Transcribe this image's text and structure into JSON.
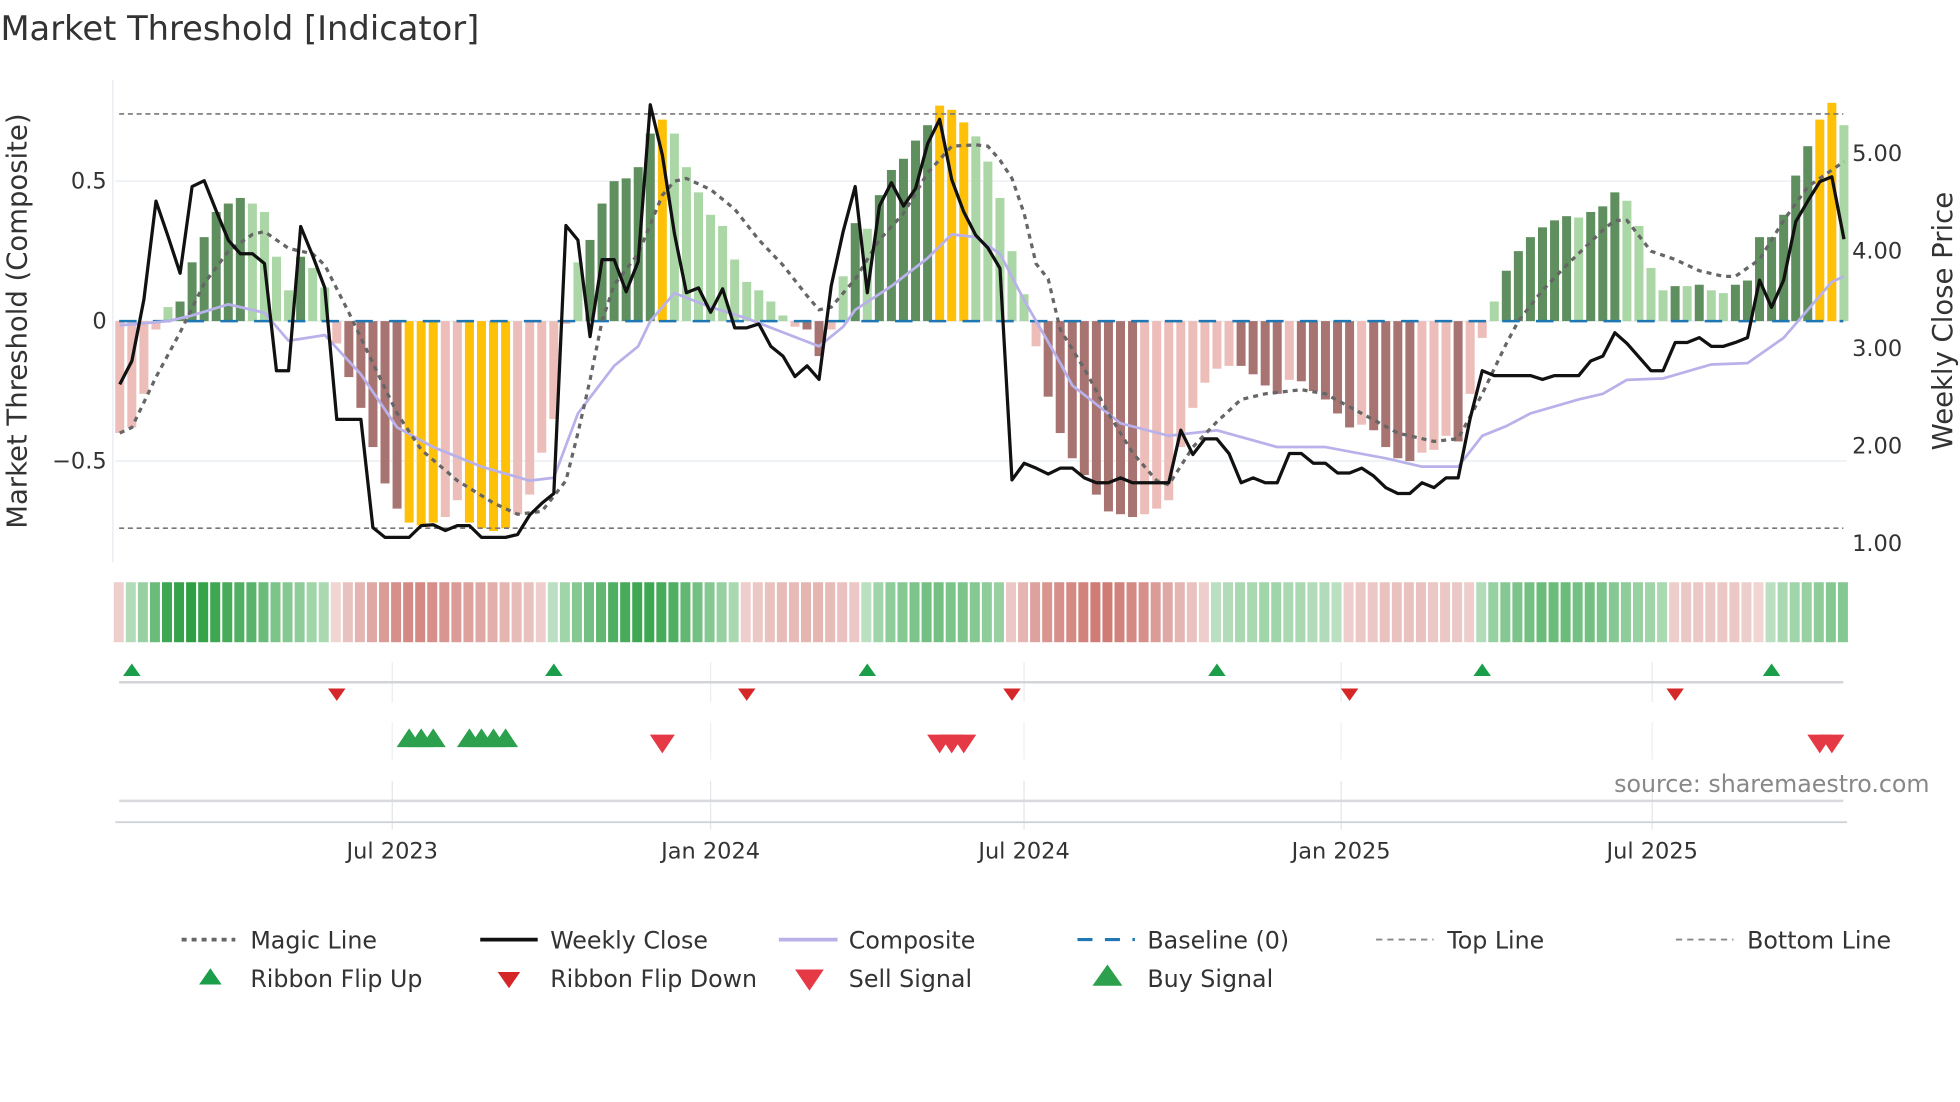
{
  "title": "Market Threshold [Indicator]",
  "source": "source: sharemaestro.com",
  "colors": {
    "dark_green": "#5f8f5f",
    "light_green": "#abd6a5",
    "dark_red": "#a87471",
    "light_red": "#ecbdb9",
    "yellow": "#ffc107",
    "magic": "#666666",
    "close": "#111111",
    "composite": "#b9b1ea",
    "baseline": "#1f77b4",
    "flip_up": "#1a9e4a",
    "flip_down": "#d62728",
    "sell": "#e63946",
    "buy": "#2ca04c",
    "ribbon_pos": "#2ea043",
    "ribbon_neg": "#c96a63"
  },
  "chart_data": {
    "type": "bar+line",
    "title": "Market Threshold [Indicator]",
    "ylabel_left": "Market Threshold (Composite)",
    "ylabel_right": "Weekly Close Price",
    "x_unit": "week index (weekly bars, ~Jan 2023 – Oct 2025)",
    "ylim_left": [
      -0.85,
      0.85
    ],
    "ylim_right": [
      0.8,
      5.7
    ],
    "left_ticks": [
      {
        "label": "0.5",
        "value": 0.5
      },
      {
        "label": "0",
        "value": 0
      },
      {
        "label": "−0.5",
        "value": -0.5
      }
    ],
    "right_ticks": [
      {
        "label": "5.00",
        "value": 5
      },
      {
        "label": "4.00",
        "value": 4
      },
      {
        "label": "3.00",
        "value": 3
      },
      {
        "label": "2.00",
        "value": 2
      },
      {
        "label": "1.00",
        "value": 1
      }
    ],
    "x_ticks": [
      {
        "label": "Jul 2023",
        "week": 22.6
      },
      {
        "label": "Jan 2024",
        "week": 49.0
      },
      {
        "label": "Jul 2024",
        "week": 75.0
      },
      {
        "label": "Jan 2025",
        "week": 101.3
      },
      {
        "label": "Jul 2025",
        "week": 127.1
      }
    ],
    "top_line": 0.74,
    "bottom_line": -0.74,
    "baseline": 0,
    "histogram": [
      -0.4,
      -0.38,
      -0.26,
      -0.03,
      0.05,
      0.07,
      0.21,
      0.3,
      0.39,
      0.42,
      0.44,
      0.42,
      0.39,
      0.23,
      0.11,
      0.23,
      0.19,
      0.12,
      -0.08,
      -0.2,
      -0.31,
      -0.45,
      -0.58,
      -0.67,
      -0.72,
      -0.73,
      -0.72,
      -0.7,
      -0.64,
      -0.72,
      -0.74,
      -0.75,
      -0.74,
      -0.69,
      -0.62,
      -0.47,
      -0.35,
      -0.01,
      0.21,
      0.29,
      0.42,
      0.5,
      0.51,
      0.55,
      0.67,
      0.72,
      0.67,
      0.55,
      0.46,
      0.38,
      0.34,
      0.22,
      0.14,
      0.11,
      0.07,
      0.02,
      -0.02,
      -0.03,
      -0.125,
      -0.03,
      0.16,
      0.35,
      0.33,
      0.45,
      0.54,
      0.58,
      0.645,
      0.7,
      0.77,
      0.755,
      0.71,
      0.66,
      0.57,
      0.44,
      0.25,
      0.096,
      -0.09,
      -0.27,
      -0.4,
      -0.49,
      -0.55,
      -0.62,
      -0.68,
      -0.69,
      -0.7,
      -0.69,
      -0.67,
      -0.64,
      -0.45,
      -0.31,
      -0.22,
      -0.17,
      -0.16,
      -0.16,
      -0.19,
      -0.23,
      -0.26,
      -0.21,
      -0.215,
      -0.25,
      -0.28,
      -0.33,
      -0.38,
      -0.37,
      -0.39,
      -0.45,
      -0.49,
      -0.5,
      -0.47,
      -0.46,
      -0.41,
      -0.43,
      -0.26,
      -0.06,
      0.07,
      0.18,
      0.25,
      0.3,
      0.335,
      0.36,
      0.375,
      0.37,
      0.39,
      0.41,
      0.46,
      0.43,
      0.34,
      0.19,
      0.11,
      0.125,
      0.125,
      0.13,
      0.11,
      0.1,
      0.13,
      0.145,
      0.3,
      0.3,
      0.38,
      0.52,
      0.625,
      0.72,
      0.78,
      0.7
    ],
    "histogram_class": [
      "lr",
      "lr",
      "lr",
      "lr",
      "lg",
      "dg",
      "dg",
      "dg",
      "dg",
      "dg",
      "dg",
      "lg",
      "lg",
      "lg",
      "lg",
      "dg",
      "lg",
      "lg",
      "lr",
      "dr",
      "dr",
      "dr",
      "dr",
      "dr",
      "y",
      "y",
      "y",
      "lr",
      "lr",
      "y",
      "y",
      "y",
      "y",
      "lr",
      "lr",
      "lr",
      "lr",
      "lr",
      "lg",
      "dg",
      "dg",
      "dg",
      "dg",
      "dg",
      "dg",
      "y",
      "lg",
      "lg",
      "lg",
      "lg",
      "lg",
      "lg",
      "lg",
      "lg",
      "lg",
      "lg",
      "lr",
      "dr",
      "dr",
      "lr",
      "lg",
      "dg",
      "lg",
      "dg",
      "dg",
      "dg",
      "dg",
      "dg",
      "y",
      "y",
      "y",
      "lg",
      "lg",
      "lg",
      "lg",
      "lg",
      "lr",
      "dr",
      "dr",
      "dr",
      "dr",
      "dr",
      "dr",
      "dr",
      "dr",
      "lr",
      "lr",
      "lr",
      "lr",
      "lr",
      "lr",
      "lr",
      "lr",
      "dr",
      "dr",
      "dr",
      "dr",
      "lr",
      "dr",
      "dr",
      "dr",
      "dr",
      "dr",
      "lr",
      "dr",
      "dr",
      "dr",
      "dr",
      "lr",
      "lr",
      "lr",
      "dr",
      "lr",
      "lr",
      "lg",
      "dg",
      "dg",
      "dg",
      "dg",
      "dg",
      "dg",
      "lg",
      "dg",
      "dg",
      "dg",
      "lg",
      "lg",
      "lg",
      "lg",
      "dg",
      "lg",
      "dg",
      "lg",
      "lg",
      "dg",
      "dg",
      "dg",
      "dg",
      "dg",
      "dg",
      "dg",
      "y",
      "y",
      "lg"
    ],
    "weekly_close": [
      2.62,
      2.86,
      3.49,
      4.5,
      4.14,
      3.76,
      4.65,
      4.71,
      4.4,
      4.1,
      3.96,
      3.96,
      3.86,
      2.76,
      2.76,
      4.24,
      3.94,
      3.61,
      2.26,
      2.26,
      2.26,
      1.15,
      1.05,
      1.05,
      1.05,
      1.17,
      1.18,
      1.12,
      1.17,
      1.17,
      1.05,
      1.05,
      1.05,
      1.08,
      1.28,
      1.4,
      1.5,
      4.25,
      4.1,
      3.11,
      3.9,
      3.9,
      3.57,
      3.88,
      5.49,
      4.97,
      4.17,
      3.56,
      3.61,
      3.36,
      3.6,
      3.2,
      3.2,
      3.24,
      3.01,
      2.91,
      2.7,
      2.81,
      2.67,
      3.63,
      4.19,
      4.65,
      3.56,
      4.45,
      4.69,
      4.45,
      4.63,
      5.09,
      5.34,
      4.72,
      4.39,
      4.15,
      4.02,
      3.81,
      1.64,
      1.81,
      1.76,
      1.7,
      1.76,
      1.76,
      1.66,
      1.61,
      1.61,
      1.66,
      1.61,
      1.61,
      1.61,
      1.61,
      2.15,
      1.9,
      2.06,
      2.06,
      1.91,
      1.61,
      1.66,
      1.61,
      1.61,
      1.91,
      1.91,
      1.81,
      1.81,
      1.71,
      1.71,
      1.76,
      1.68,
      1.56,
      1.5,
      1.5,
      1.61,
      1.56,
      1.66,
      1.66,
      2.27,
      2.76,
      2.71,
      2.71,
      2.71,
      2.71,
      2.67,
      2.71,
      2.71,
      2.71,
      2.86,
      2.91,
      3.15,
      3.04,
      2.9,
      2.76,
      2.76,
      3.05,
      3.05,
      3.1,
      3.01,
      3.01,
      3.05,
      3.1,
      3.69,
      3.41,
      3.69,
      4.29,
      4.5,
      4.7,
      4.75,
      4.11
    ],
    "composite": [
      [
        0,
        -0.015
      ],
      [
        4,
        0.0
      ],
      [
        6,
        0.02
      ],
      [
        9,
        0.06
      ],
      [
        12,
        0.03
      ],
      [
        14,
        -0.07
      ],
      [
        17,
        -0.05
      ],
      [
        20,
        -0.19
      ],
      [
        23,
        -0.38
      ],
      [
        26,
        -0.45
      ],
      [
        30,
        -0.52
      ],
      [
        34,
        -0.57
      ],
      [
        36,
        -0.56
      ],
      [
        38,
        -0.33
      ],
      [
        41,
        -0.16
      ],
      [
        43,
        -0.09
      ],
      [
        44,
        0.0
      ],
      [
        46,
        0.1
      ],
      [
        49,
        0.05
      ],
      [
        52,
        0.01
      ],
      [
        55,
        -0.04
      ],
      [
        58,
        -0.09
      ],
      [
        60,
        -0.02
      ],
      [
        61,
        0.04
      ],
      [
        64,
        0.125
      ],
      [
        67,
        0.225
      ],
      [
        69,
        0.31
      ],
      [
        71,
        0.3
      ],
      [
        73,
        0.24
      ],
      [
        75,
        0.075
      ],
      [
        78,
        -0.15
      ],
      [
        79,
        -0.23
      ],
      [
        83,
        -0.365
      ],
      [
        87,
        -0.41
      ],
      [
        91,
        -0.39
      ],
      [
        96,
        -0.45
      ],
      [
        100,
        -0.45
      ],
      [
        105,
        -0.49
      ],
      [
        108,
        -0.52
      ],
      [
        111,
        -0.52
      ],
      [
        113,
        -0.41
      ],
      [
        115,
        -0.375
      ],
      [
        117,
        -0.33
      ],
      [
        121,
        -0.28
      ],
      [
        123,
        -0.26
      ],
      [
        125,
        -0.21
      ],
      [
        128,
        -0.205
      ],
      [
        132,
        -0.155
      ],
      [
        135,
        -0.15
      ],
      [
        137,
        -0.09
      ],
      [
        138,
        -0.06
      ],
      [
        140,
        0.04
      ],
      [
        142,
        0.14
      ],
      [
        143,
        0.16
      ]
    ],
    "magic_line": [
      [
        0,
        -0.4
      ],
      [
        1,
        -0.38
      ],
      [
        3,
        -0.2
      ],
      [
        5,
        -0.04
      ],
      [
        7,
        0.135
      ],
      [
        9,
        0.25
      ],
      [
        11,
        0.31
      ],
      [
        12,
        0.32
      ],
      [
        14,
        0.26
      ],
      [
        16,
        0.24
      ],
      [
        17,
        0.2
      ],
      [
        19,
        0.03
      ],
      [
        21,
        -0.15
      ],
      [
        23,
        -0.33
      ],
      [
        25,
        -0.46
      ],
      [
        28,
        -0.57
      ],
      [
        31,
        -0.65
      ],
      [
        33,
        -0.69
      ],
      [
        35,
        -0.68
      ],
      [
        37,
        -0.57
      ],
      [
        38,
        -0.4
      ],
      [
        39,
        -0.21
      ],
      [
        40,
        0.0
      ],
      [
        41,
        0.13
      ],
      [
        43,
        0.24
      ],
      [
        45,
        0.45
      ],
      [
        46,
        0.5
      ],
      [
        47,
        0.51
      ],
      [
        49,
        0.47
      ],
      [
        51,
        0.4
      ],
      [
        53,
        0.29
      ],
      [
        55,
        0.2
      ],
      [
        57,
        0.09
      ],
      [
        58,
        0.04
      ],
      [
        59,
        0.05
      ],
      [
        61,
        0.15
      ],
      [
        63,
        0.29
      ],
      [
        65,
        0.385
      ],
      [
        67,
        0.53
      ],
      [
        69,
        0.625
      ],
      [
        71,
        0.63
      ],
      [
        72,
        0.625
      ],
      [
        73,
        0.575
      ],
      [
        74,
        0.51
      ],
      [
        75,
        0.385
      ],
      [
        76,
        0.205
      ],
      [
        77,
        0.15
      ],
      [
        78,
        -0.03
      ],
      [
        80,
        -0.17
      ],
      [
        82,
        -0.33
      ],
      [
        84,
        -0.47
      ],
      [
        86,
        -0.57
      ],
      [
        87,
        -0.585
      ],
      [
        89,
        -0.45
      ],
      [
        91,
        -0.36
      ],
      [
        93,
        -0.28
      ],
      [
        95,
        -0.26
      ],
      [
        98,
        -0.245
      ],
      [
        100,
        -0.26
      ],
      [
        103,
        -0.33
      ],
      [
        106,
        -0.4
      ],
      [
        109,
        -0.43
      ],
      [
        111,
        -0.42
      ],
      [
        113,
        -0.26
      ],
      [
        115,
        -0.08
      ],
      [
        116,
        0.0
      ],
      [
        118,
        0.11
      ],
      [
        120,
        0.2
      ],
      [
        123,
        0.325
      ],
      [
        124,
        0.36
      ],
      [
        125,
        0.36
      ],
      [
        127,
        0.25
      ],
      [
        129,
        0.22
      ],
      [
        131,
        0.18
      ],
      [
        133,
        0.16
      ],
      [
        134,
        0.16
      ],
      [
        136,
        0.22
      ],
      [
        138,
        0.36
      ],
      [
        140,
        0.48
      ],
      [
        143,
        0.57
      ]
    ],
    "ribbon": [
      -0.15,
      0.2,
      0.35,
      0.6,
      0.85,
      0.9,
      0.95,
      0.9,
      0.85,
      0.8,
      0.75,
      0.7,
      0.6,
      0.5,
      0.45,
      0.4,
      0.3,
      0.25,
      -0.1,
      -0.25,
      -0.35,
      -0.45,
      -0.55,
      -0.65,
      -0.7,
      -0.7,
      -0.65,
      -0.6,
      -0.55,
      -0.5,
      -0.45,
      -0.4,
      -0.35,
      -0.3,
      -0.25,
      -0.15,
      0.15,
      0.3,
      0.45,
      0.55,
      0.65,
      0.75,
      0.8,
      0.85,
      0.85,
      0.8,
      0.75,
      0.65,
      0.55,
      0.45,
      0.35,
      0.25,
      -0.15,
      -0.2,
      -0.25,
      -0.3,
      -0.3,
      -0.35,
      -0.35,
      -0.3,
      -0.25,
      -0.2,
      0.15,
      0.3,
      0.4,
      0.45,
      0.5,
      0.55,
      0.55,
      0.5,
      0.5,
      0.45,
      0.4,
      0.35,
      -0.2,
      -0.35,
      -0.5,
      -0.6,
      -0.65,
      -0.7,
      -0.75,
      -0.8,
      -0.8,
      -0.75,
      -0.7,
      -0.65,
      -0.55,
      -0.45,
      -0.35,
      -0.25,
      -0.15,
      0.15,
      0.2,
      0.25,
      0.25,
      0.3,
      0.3,
      0.25,
      0.25,
      0.2,
      0.2,
      0.15,
      -0.15,
      -0.2,
      -0.2,
      -0.25,
      -0.25,
      -0.25,
      -0.25,
      -0.2,
      -0.2,
      -0.2,
      -0.15,
      0.2,
      0.35,
      0.45,
      0.5,
      0.55,
      0.6,
      0.6,
      0.6,
      0.55,
      0.55,
      0.5,
      0.45,
      0.4,
      0.35,
      0.3,
      0.25,
      -0.15,
      -0.2,
      -0.2,
      -0.2,
      -0.2,
      -0.2,
      -0.15,
      -0.1,
      0.15,
      0.25,
      0.3,
      0.35,
      0.4,
      0.45,
      0.45
    ],
    "ribbon_flip_up": [
      1,
      36,
      62,
      91,
      113,
      137
    ],
    "ribbon_flip_down": [
      18,
      52,
      74,
      102,
      129
    ],
    "buy_signals": [
      24,
      25,
      26,
      29,
      30,
      31,
      32
    ],
    "sell_signals": [
      45,
      68,
      69,
      70,
      141,
      142
    ],
    "legend": {
      "position": "bottom",
      "items": [
        "Magic Line",
        "Weekly Close",
        "Composite",
        "Baseline (0)",
        "Top Line",
        "Bottom Line",
        "Ribbon Flip Up",
        "Ribbon Flip Down",
        "Sell Signal",
        "Buy Signal"
      ]
    }
  }
}
